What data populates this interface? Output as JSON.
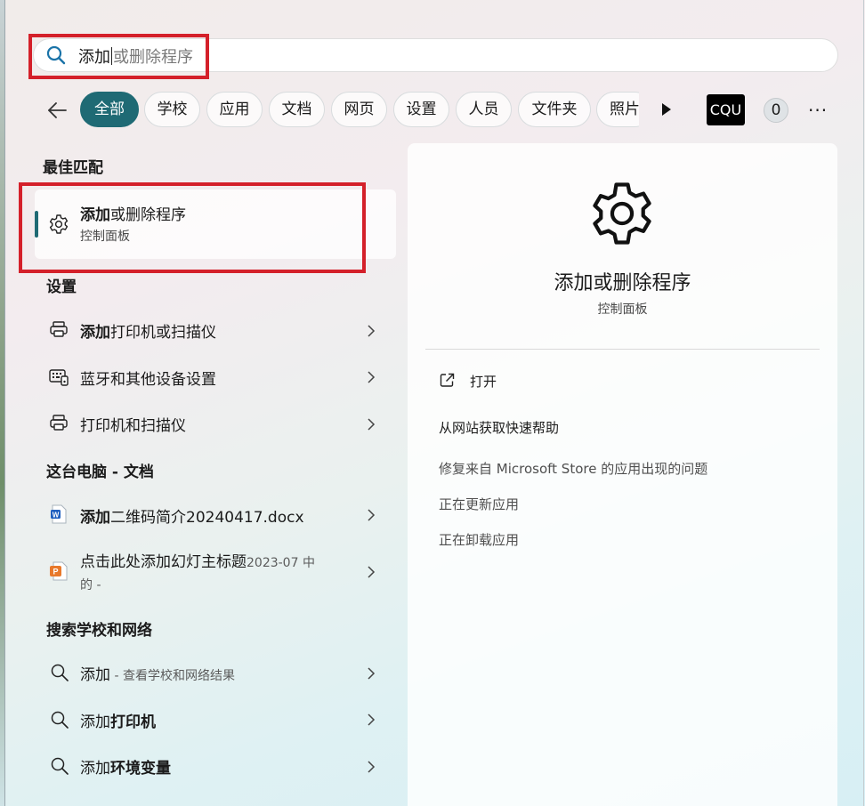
{
  "search": {
    "typed": "添加",
    "rest": "或删除程序"
  },
  "tabs": [
    "全部",
    "学校",
    "应用",
    "文档",
    "网页",
    "设置",
    "人员",
    "文件夹",
    "照片"
  ],
  "account": {
    "org": "CQU",
    "points": "0"
  },
  "best_match": {
    "heading": "最佳匹配",
    "title_bold": "添加",
    "title_rest": "或删除程序",
    "subtitle": "控制面板"
  },
  "settings_section": {
    "heading": "设置",
    "items": [
      {
        "bold": "添加",
        "rest": "打印机或扫描仪"
      },
      {
        "bold": "",
        "rest": "蓝牙和其他设备设置"
      },
      {
        "bold": "",
        "rest": "打印机和扫描仪"
      }
    ]
  },
  "documents_section": {
    "heading": "这台电脑 - 文档",
    "items": [
      {
        "bold": "添加",
        "rest": "二维码简介20240417.docx"
      },
      {
        "title": "点击此处添加幻灯主标题",
        "meta_line1": "2023-07 中",
        "meta_line2": "的 -"
      }
    ]
  },
  "web_section": {
    "heading": "搜索学校和网络",
    "items": [
      {
        "normal": "添加",
        "suffix": " - 查看学校和网络结果"
      },
      {
        "normal": "添加",
        "bold": "打印机"
      },
      {
        "normal": "添加",
        "bold": "环境变量"
      }
    ]
  },
  "preview": {
    "title": "添加或删除程序",
    "subtitle": "控制面板",
    "open": "打开",
    "help_heading": "从网站获取快速帮助",
    "links": [
      "修复来自 Microsoft Store 的应用出现的问题",
      "正在更新应用",
      "正在卸载应用"
    ]
  },
  "colors": {
    "accent": "#1f6a74",
    "highlight_box": "#d4202a"
  },
  "icons": [
    "search-icon",
    "back-arrow-icon",
    "play-icon",
    "more-icon",
    "gear-icon",
    "printer-icon",
    "keyboard-icon",
    "word-doc-icon",
    "powerpoint-icon",
    "chevron-right-icon",
    "open-external-icon"
  ]
}
